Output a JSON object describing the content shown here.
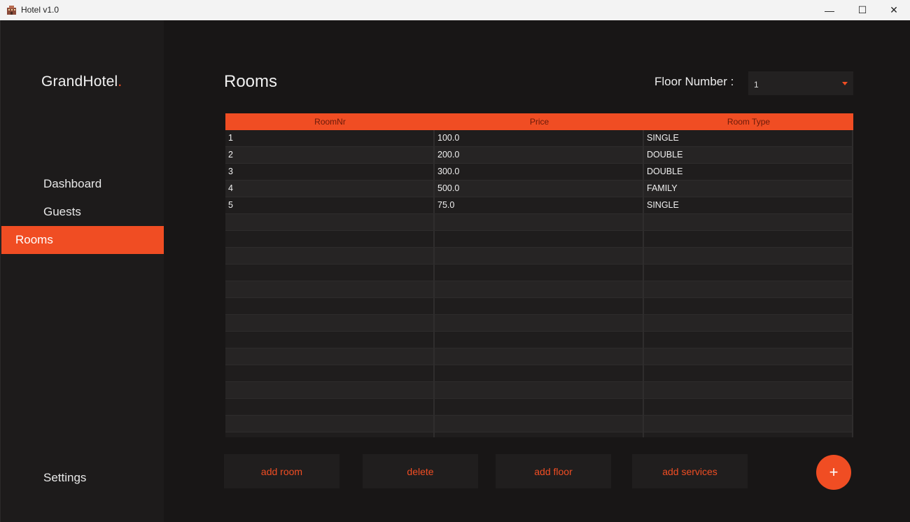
{
  "window": {
    "title": "Hotel v1.0",
    "minimize": "—",
    "maximize": "☐",
    "close": "✕"
  },
  "sidebar": {
    "brand": "GrandHotel",
    "brand_dot": ".",
    "items": [
      {
        "label": "Dashboard"
      },
      {
        "label": "Guests"
      },
      {
        "label": "Rooms"
      }
    ],
    "settings": "Settings"
  },
  "main": {
    "title": "Rooms",
    "floor_label": "Floor Number :",
    "floor_value": "1",
    "table": {
      "columns": [
        "RoomNr",
        "Price",
        "Room Type"
      ],
      "rows": [
        [
          "1",
          "100.0",
          "SINGLE"
        ],
        [
          "2",
          "200.0",
          "DOUBLE"
        ],
        [
          "3",
          "300.0",
          "DOUBLE"
        ],
        [
          "4",
          "500.0",
          "FAMILY"
        ],
        [
          "5",
          "75.0",
          "SINGLE"
        ],
        [
          "",
          "",
          ""
        ],
        [
          "",
          "",
          ""
        ],
        [
          "",
          "",
          ""
        ],
        [
          "",
          "",
          ""
        ],
        [
          "",
          "",
          ""
        ],
        [
          "",
          "",
          ""
        ],
        [
          "",
          "",
          ""
        ],
        [
          "",
          "",
          ""
        ],
        [
          "",
          "",
          ""
        ],
        [
          "",
          "",
          ""
        ],
        [
          "",
          "",
          ""
        ],
        [
          "",
          "",
          ""
        ],
        [
          "",
          "",
          ""
        ],
        [
          "",
          "",
          ""
        ]
      ]
    },
    "buttons": {
      "add_room": "add room",
      "delete": "delete",
      "add_floor": "add floor",
      "add_services": "add services",
      "fab": "+"
    }
  },
  "colors": {
    "accent": "#f04d23",
    "background": "#181616",
    "sidebar": "#1d1b1b"
  },
  "icons": {
    "app": "hotel-building-icon",
    "caret": "chevron-down-icon"
  }
}
